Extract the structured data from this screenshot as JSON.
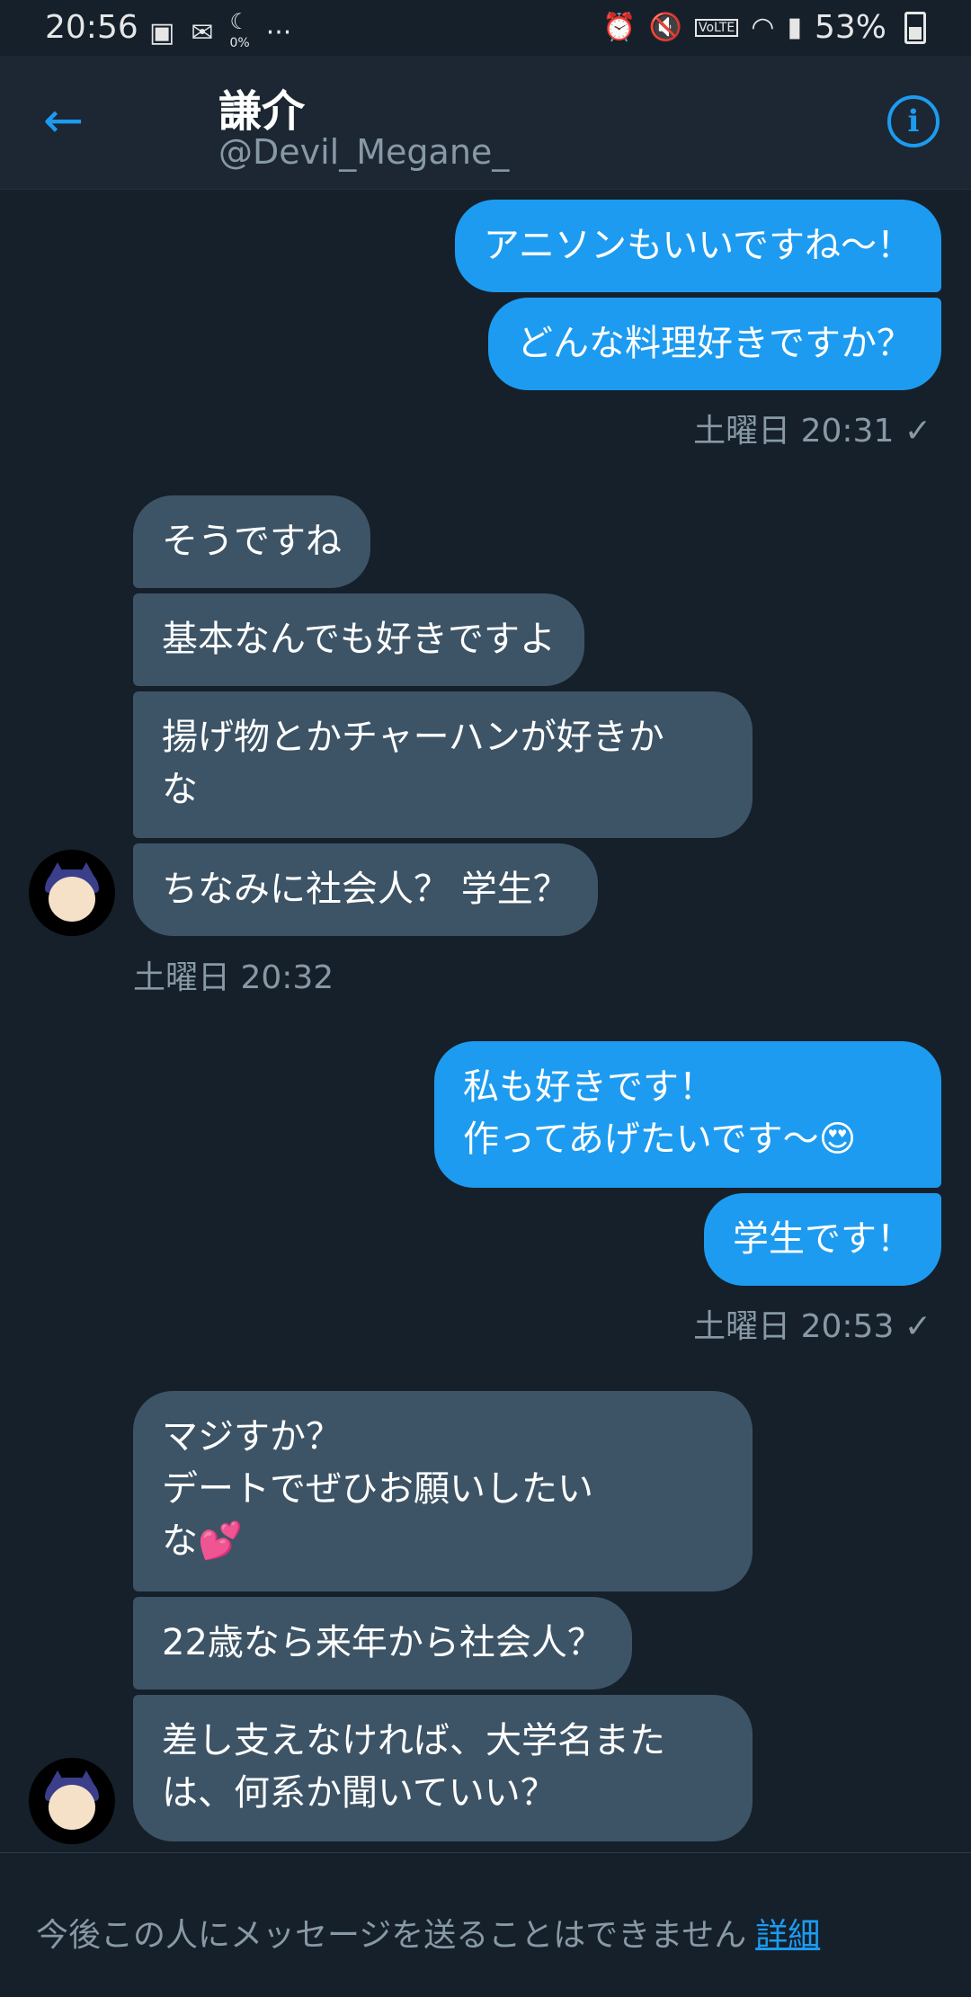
{
  "status_bar": {
    "time": "20:56",
    "icons_left": [
      "image-icon",
      "mail-icon",
      "moon-icon",
      "more-icon"
    ],
    "small_percent": "0%",
    "icons_right": [
      "alarm-icon",
      "mute-icon",
      "volte-icon",
      "wifi-icon",
      "signal-icon"
    ],
    "volte": "VoLTE",
    "battery": "53%"
  },
  "header": {
    "name": "謙介",
    "handle": "@Devil_Megane_"
  },
  "messages": [
    {
      "text": "アニソンもいいですね〜！",
      "dir": "out"
    },
    {
      "text": "どんな料理好きですか？",
      "dir": "out"
    },
    {
      "ts": "土曜日 20:31"
    },
    {
      "text": "そうですね",
      "dir": "in"
    },
    {
      "text": "基本なんでも好きですよ",
      "dir": "in"
    },
    {
      "text": "揚げ物とかチャーハンが好きか\nな",
      "dir": "in"
    },
    {
      "text": "ちなみに社会人？ 学生？",
      "dir": "in"
    },
    {
      "ts": "土曜日 20:32"
    },
    {
      "text": "私も好きです！\n作ってあげたいです〜😍",
      "dir": "out"
    },
    {
      "text": "学生です！",
      "dir": "out"
    },
    {
      "ts": "土曜日 20:53"
    },
    {
      "text": "マジすか？\nデートでぜひお願いしたい\nな💕",
      "dir": "in"
    },
    {
      "text": "22歳なら来年から社会人？",
      "dir": "in"
    },
    {
      "text": "差し支えなければ、大学名また\nは、何系か聞いていい？",
      "dir": "in"
    }
  ],
  "read_mark": "✓",
  "footer": {
    "notice": "今後この人にメッセージを送ることはできません",
    "link": "詳細"
  }
}
